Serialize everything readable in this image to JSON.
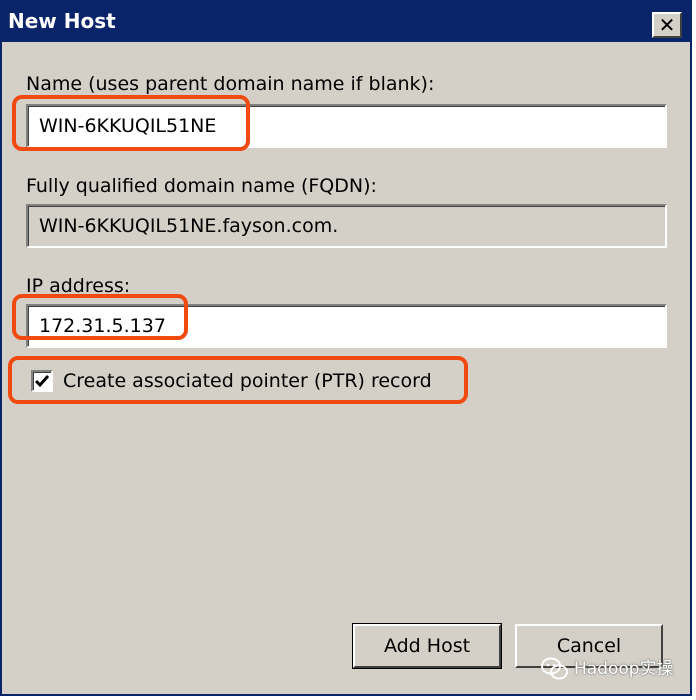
{
  "window": {
    "title": "New Host",
    "close_glyph": "✕"
  },
  "name": {
    "label": "Name (uses parent domain name if blank):",
    "value": "WIN-6KKUQIL51NE"
  },
  "fqdn": {
    "label": "Fully qualified domain name (FQDN):",
    "value": "WIN-6KKUQIL51NE.fayson.com."
  },
  "ip": {
    "label": "IP address:",
    "value": "172.31.5.137"
  },
  "ptr": {
    "label": "Create associated pointer (PTR) record",
    "checked": true
  },
  "buttons": {
    "add_host": "Add Host",
    "cancel": "Cancel"
  },
  "watermark": {
    "text": "Hadoop实操",
    "icon": "wechat-icon"
  },
  "colors": {
    "titlebar": "#0a246a",
    "dialog_bg": "#d4d0c8",
    "highlight": "#f04a10"
  }
}
